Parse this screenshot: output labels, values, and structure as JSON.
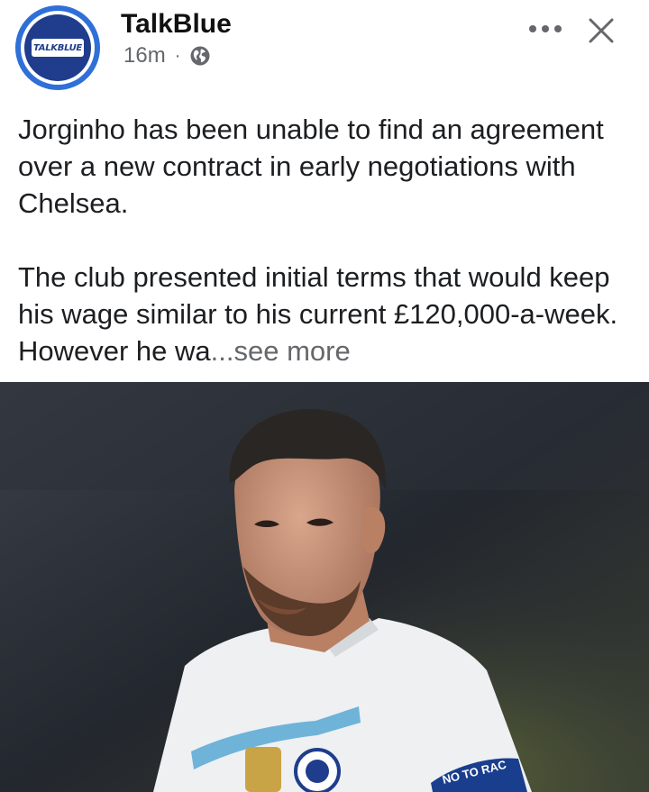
{
  "post": {
    "page_name": "TalkBlue",
    "avatar_text": "TALKBLUE",
    "time": "16m",
    "separator": "·",
    "more_icon": "more-dots-icon",
    "close_icon": "close-icon",
    "privacy_icon": "globe-icon",
    "paragraph_1": "Jorginho has been unable to find an agreement over a new contract in early negotiations with Chelsea.",
    "paragraph_2_visible": "The club presented initial terms that would keep his wage similar to his current £120,000-a-week. However he wa",
    "ellipsis": "...",
    "see_more": "see more",
    "photo_badge_text": "NO TO RAC"
  },
  "colors": {
    "brand_blue": "#2f6fd8",
    "text_primary": "#1c1e21",
    "text_secondary": "#65676b"
  }
}
